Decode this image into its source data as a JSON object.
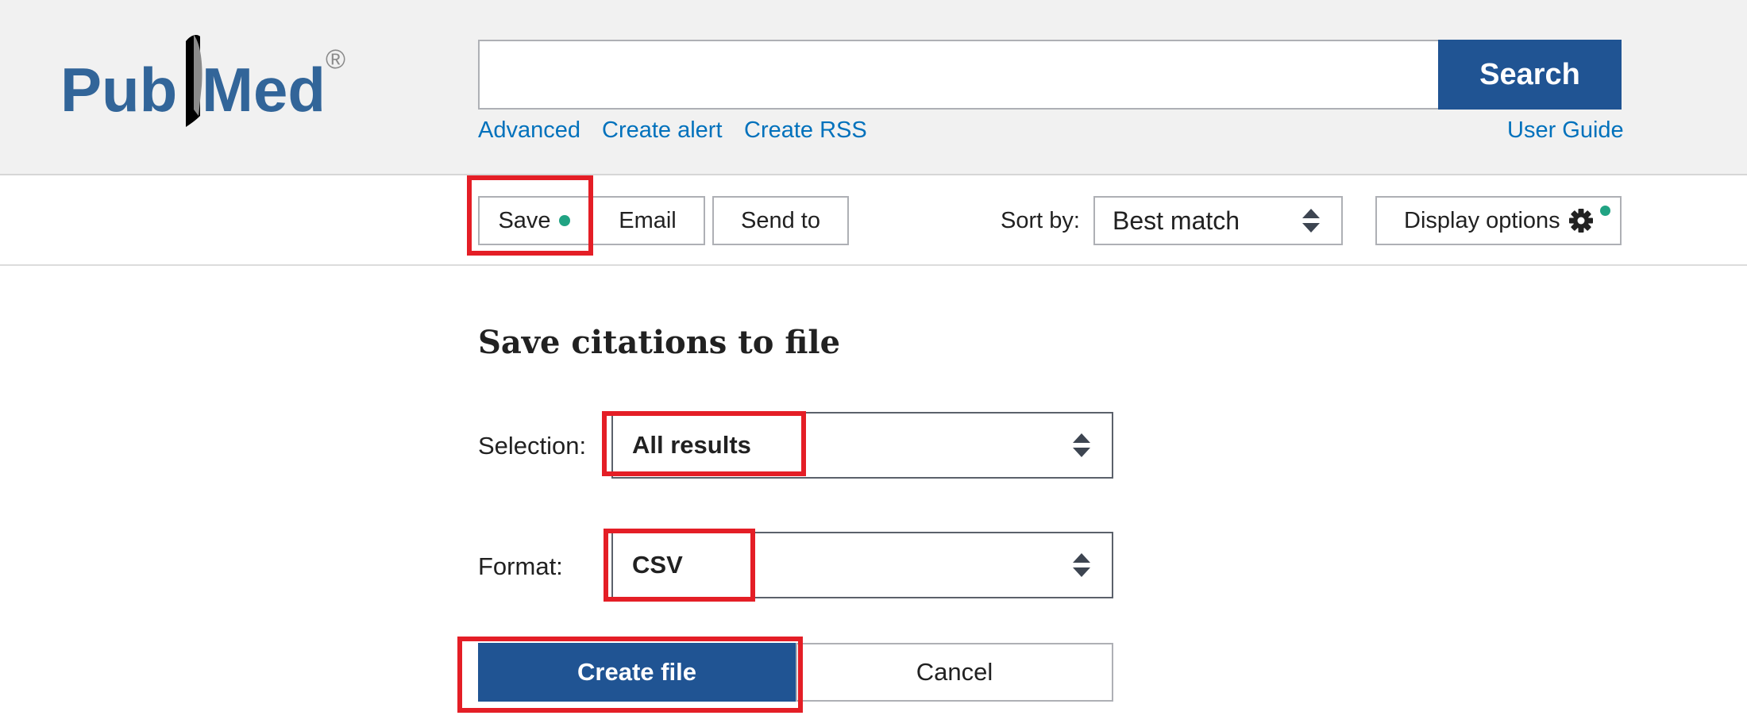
{
  "brand": {
    "logo_text_left": "Pub",
    "logo_text_right": "Med",
    "registered": "®"
  },
  "search": {
    "value": "",
    "placeholder": "",
    "button_label": "Search"
  },
  "header_links": {
    "advanced": "Advanced",
    "create_alert": "Create alert",
    "create_rss": "Create RSS",
    "user_guide": "User Guide"
  },
  "actions": {
    "save": "Save",
    "email": "Email",
    "send_to": "Send to"
  },
  "sort": {
    "label": "Sort by:",
    "value": "Best match"
  },
  "display_options": {
    "label": "Display options"
  },
  "save_form": {
    "title": "Save citations to file",
    "selection_label": "Selection:",
    "selection_value": "All results",
    "format_label": "Format:",
    "format_value": "CSV",
    "create_button": "Create file",
    "cancel_button": "Cancel"
  },
  "icons": {
    "sort": "up-down-arrows-icon",
    "settings": "gear-icon",
    "status": "status-dot-icon"
  },
  "colors": {
    "primary": "#205493",
    "link": "#0071bc",
    "indicator": "#20a383",
    "highlight": "#e41e26",
    "header_bg": "#f1f1f1"
  }
}
